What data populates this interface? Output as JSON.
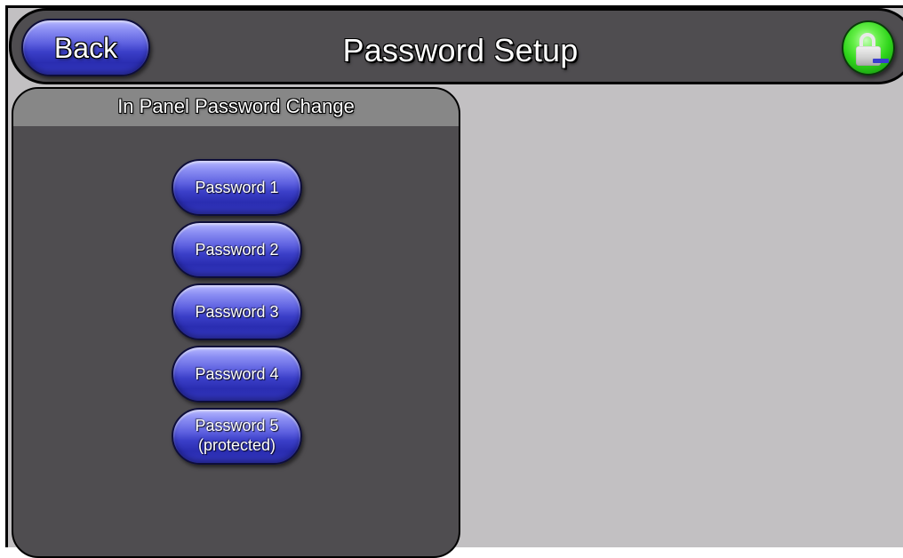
{
  "header": {
    "title": "Password Setup",
    "back_label": "Back",
    "lock_icon": "lock-icon",
    "lock_color": "#2ed41a"
  },
  "panel": {
    "title": "In Panel Password Change",
    "buttons": [
      {
        "label": "Password 1"
      },
      {
        "label": "Password 2"
      },
      {
        "label": "Password 3"
      },
      {
        "label": "Password 4"
      },
      {
        "label_line1": "Password 5",
        "label_line2": "(protected)"
      }
    ]
  },
  "colors": {
    "background": "#c2c0c2",
    "panel": "#4f4d50",
    "panel_header": "#878787",
    "button_blue": "#3b3fc8"
  }
}
